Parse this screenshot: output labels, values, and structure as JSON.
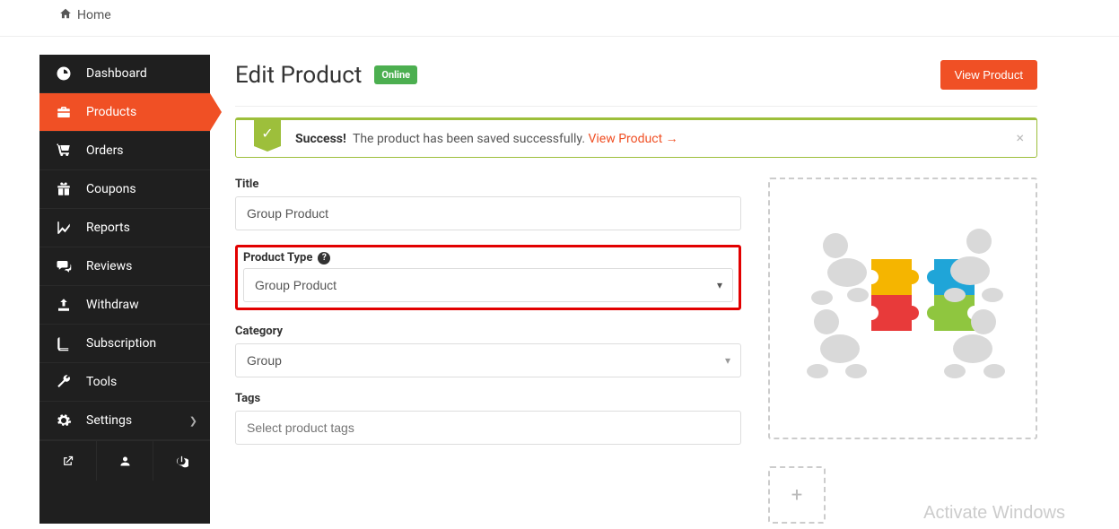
{
  "breadcrumb": {
    "home_label": "Home"
  },
  "sidebar": {
    "items": [
      {
        "label": "Dashboard"
      },
      {
        "label": "Products"
      },
      {
        "label": "Orders"
      },
      {
        "label": "Coupons"
      },
      {
        "label": "Reports"
      },
      {
        "label": "Reviews"
      },
      {
        "label": "Withdraw"
      },
      {
        "label": "Subscription"
      },
      {
        "label": "Tools"
      },
      {
        "label": "Settings"
      }
    ]
  },
  "page": {
    "title": "Edit Product",
    "status_badge": "Online",
    "view_button": "View Product"
  },
  "alert": {
    "strong": "Success!",
    "message": "The product has been saved successfully. ",
    "link_text": "View Product →"
  },
  "form": {
    "title_label": "Title",
    "title_value": "Group Product",
    "product_type_label": "Product Type",
    "product_type_value": "Group Product",
    "category_label": "Category",
    "category_value": "Group",
    "tags_label": "Tags",
    "tags_placeholder": "Select product tags"
  },
  "watermark": "Activate Windows"
}
